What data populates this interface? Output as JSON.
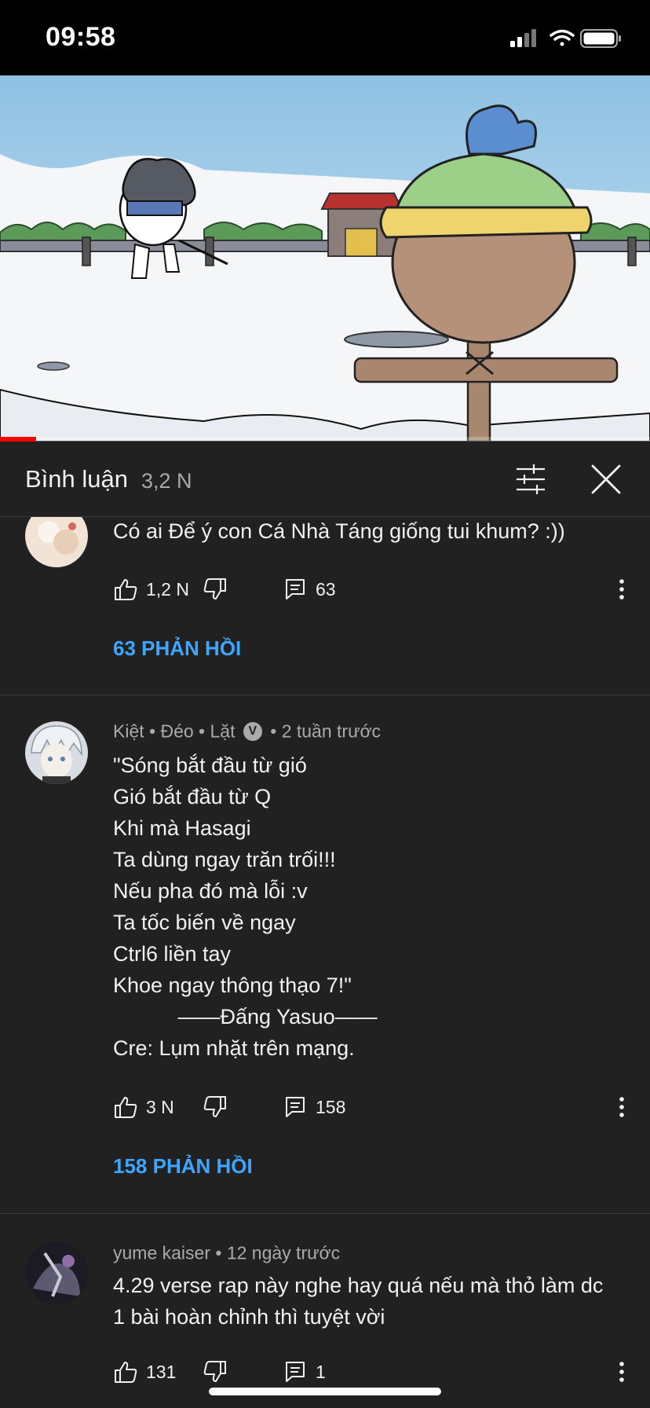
{
  "status_bar": {
    "time": "09:58"
  },
  "video": {
    "progress_fraction": 0.055,
    "progress_color": "#ff0000"
  },
  "comments_panel": {
    "title": "Bình luận",
    "count": "3,2 N",
    "filter_icon": "sliders-icon",
    "close_icon": "close-icon"
  },
  "comments": [
    {
      "text_lines": [
        "Có ai Để ý con Cá Nhà Táng giống tui khum? :))"
      ],
      "likes": "1,2 N",
      "reply_count": "63",
      "replies_label": "63 PHẢN HỒI"
    },
    {
      "author": "Kiệt • Đéo • Lặt",
      "verified_mark": "V",
      "time": "• 2 tuần trước",
      "text_lines": [
        "\"Sóng bắt đầu từ gió",
        "Gió bắt đầu từ Q",
        "Khi mà Hasagi",
        "Ta dùng ngay trăn trối!!!",
        "Nếu pha đó mà lỗi :v",
        "Ta tốc biến về ngay",
        "Ctrl6 liền tay",
        "Khoe ngay thông thạo 7!\"",
        "           ——Đấng Yasuo——",
        "Cre: Lụm nhặt trên mạng."
      ],
      "likes": "3 N",
      "reply_count": "158",
      "replies_label": "158 PHẢN HỒI"
    },
    {
      "author": "yume kaiser",
      "time": "• 12 ngày trước",
      "text_lines": [
        "4.29 verse rap này nghe hay quá nếu mà thỏ làm dc",
        "1 bài hoàn chỉnh thì tuyệt vời"
      ],
      "likes": "131",
      "reply_count": "1"
    }
  ],
  "colors": {
    "background": "#212121",
    "accent_link": "#3ea6ff",
    "secondary_text": "#aaaaaa"
  }
}
